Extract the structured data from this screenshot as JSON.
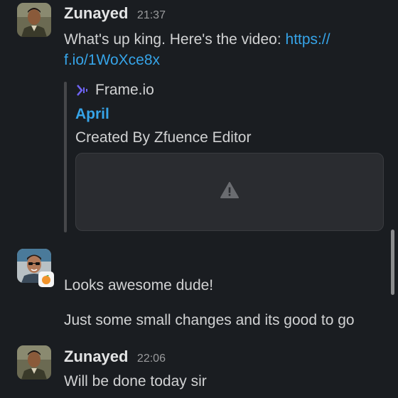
{
  "messages": [
    {
      "author": "Zunayed",
      "time": "21:37",
      "text_prefix": "What's up king. Here's the video: ",
      "link_part1": "https://",
      "link_part2": "f.io/1WoXce8x",
      "unfurl": {
        "service": "Frame.io",
        "title": "April",
        "description": "Created By Zfuence Editor",
        "preview_icon": "warning-icon"
      }
    },
    {
      "author_avatar_status": "orange-emoji",
      "lines": [
        "Looks awesome dude!",
        "Just some small changes and its good to go"
      ]
    },
    {
      "author": "Zunayed",
      "time": "22:06",
      "text": "Will be done today sir"
    }
  ],
  "colors": {
    "background": "#1a1d21",
    "link": "#36a4e8",
    "text": "#d1d2d3"
  }
}
